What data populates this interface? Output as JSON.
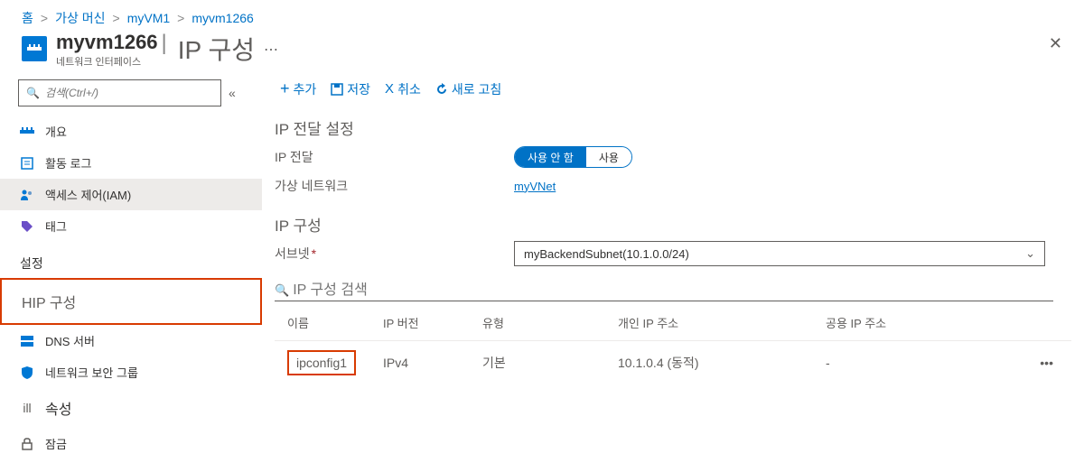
{
  "breadcrumb": {
    "home": "홈",
    "vm": "가상 머신",
    "vm1": "myVM1",
    "vm2": "myvm1266"
  },
  "header": {
    "title": "myvm1266",
    "subtitle": "네트워크 인터페이스",
    "page": "IP 구성"
  },
  "sidebar": {
    "search_placeholder": "검색(Ctrl+/)",
    "overview": "개요",
    "activity_log": "활동 로그",
    "access_control": "액세스 제어(IAM)",
    "tags": "태그",
    "section_settings": "설정",
    "ip_config": "HIP 구성",
    "dns_servers": "DNS 서버",
    "nsg": "네트워크 보안 그룹",
    "properties": "속성",
    "locks": "잠금"
  },
  "toolbar": {
    "add": "추가",
    "save": "저장",
    "discard": "취소",
    "refresh": "새로 고침"
  },
  "forwarding": {
    "section": "IP 전달 설정",
    "label": "IP 전달",
    "disabled": "사용 안 함",
    "enabled": "사용",
    "vnet_label": "가상 네트워크",
    "vnet_value": "myVNet"
  },
  "ipconfig": {
    "section": "IP 구성",
    "subnet_label": "서브넷",
    "subnet_value": "myBackendSubnet(10.1.0.0/24)",
    "search_placeholder": "IP 구성 검색"
  },
  "table": {
    "head": {
      "name": "이름",
      "version": "IP 버전",
      "type": "유형",
      "private": "개인 IP 주소",
      "public": "공용 IP 주소"
    },
    "rows": [
      {
        "name": "ipconfig1",
        "version": "IPv4",
        "type": "기본",
        "private": "10.1.0.4 (동적)",
        "public": "-"
      }
    ]
  }
}
